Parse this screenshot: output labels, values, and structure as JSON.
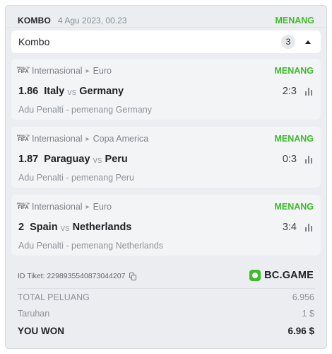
{
  "header": {
    "title": "KOMBO",
    "date": "4 Agu 2023, 00.23",
    "status": "MENANG"
  },
  "combo": {
    "label": "Kombo",
    "count": "3",
    "caret_icon": "caret-up-icon"
  },
  "matches": [
    {
      "league": "Internasional",
      "tournament": "Euro",
      "status": "MENANG",
      "odds": "1.86",
      "home": "Italy",
      "vs": "vs",
      "away": "Germany",
      "score": "2:3",
      "pick": "Adu Penalti - pemenang Germany"
    },
    {
      "league": "Internasional",
      "tournament": "Copa America",
      "status": "MENANG",
      "odds": "1.87",
      "home": "Paraguay",
      "vs": "vs",
      "away": "Peru",
      "score": "0:3",
      "pick": "Adu Penalti - pemenang Peru"
    },
    {
      "league": "Internasional",
      "tournament": "Euro",
      "status": "MENANG",
      "odds": "2",
      "home": "Spain",
      "vs": "vs",
      "away": "Netherlands",
      "score": "3:4",
      "pick": "Adu Penalti - pemenang Netherlands"
    }
  ],
  "ticket": {
    "id_label": "ID Tiket: 2298935540873044207",
    "brand": "BC.GAME"
  },
  "summary": {
    "total_odds_label": "TOTAL PELUANG",
    "total_odds_value": "6.956",
    "stake_label": "Taruhan",
    "stake_value": "1 $",
    "won_label": "YOU WON",
    "won_value": "6.96 $"
  },
  "colors": {
    "win_green": "#3ebc2c",
    "card_bg": "#f3f4f6",
    "panel_bg": "#ebedf0"
  }
}
